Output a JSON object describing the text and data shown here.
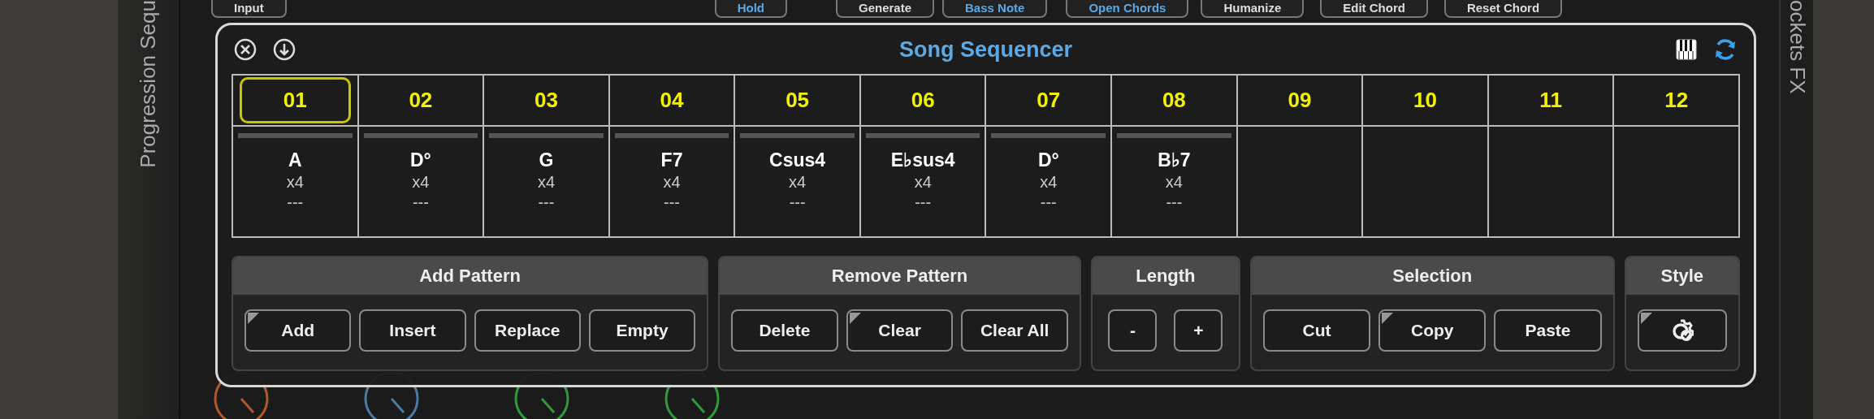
{
  "background": {
    "side_label": "Progression Sequ",
    "right_label": "ockets FX",
    "top_buttons": [
      {
        "label": "Input",
        "highlighted": false
      },
      {
        "label": "Hold",
        "highlighted": true
      },
      {
        "label": "Generate",
        "highlighted": false
      },
      {
        "label": "Bass Note",
        "highlighted": true
      },
      {
        "label": "Open Chords",
        "highlighted": true
      },
      {
        "label": "Humanize",
        "highlighted": false
      },
      {
        "label": "Edit Chord",
        "highlighted": false
      },
      {
        "label": "Reset Chord",
        "highlighted": false
      }
    ],
    "knobs": [
      {
        "color": "#b0582a"
      },
      {
        "color": "#4a7aa8"
      },
      {
        "color": "#2f9a3a"
      },
      {
        "color": "#2f9a3a"
      }
    ]
  },
  "window": {
    "title": "Song Sequencer",
    "slots": [
      {
        "number": "01",
        "selected": true,
        "chord": "A",
        "repeat": "x4",
        "pattern": "---"
      },
      {
        "number": "02",
        "selected": false,
        "chord": "D°",
        "repeat": "x4",
        "pattern": "---"
      },
      {
        "number": "03",
        "selected": false,
        "chord": "G",
        "repeat": "x4",
        "pattern": "---"
      },
      {
        "number": "04",
        "selected": false,
        "chord": "F7",
        "repeat": "x4",
        "pattern": "---"
      },
      {
        "number": "05",
        "selected": false,
        "chord": "Csus4",
        "repeat": "x4",
        "pattern": "---"
      },
      {
        "number": "06",
        "selected": false,
        "chord": "E♭sus4",
        "repeat": "x4",
        "pattern": "---"
      },
      {
        "number": "07",
        "selected": false,
        "chord": "D°",
        "repeat": "x4",
        "pattern": "---"
      },
      {
        "number": "08",
        "selected": false,
        "chord": "B♭7",
        "repeat": "x4",
        "pattern": "---"
      },
      {
        "number": "09",
        "selected": false
      },
      {
        "number": "10",
        "selected": false
      },
      {
        "number": "11",
        "selected": false
      },
      {
        "number": "12",
        "selected": false
      }
    ],
    "sections": [
      {
        "title": "Add Pattern",
        "buttons": [
          {
            "label": "Add",
            "corner_mark": true
          },
          {
            "label": "Insert",
            "corner_mark": false
          },
          {
            "label": "Replace",
            "corner_mark": false
          },
          {
            "label": "Empty",
            "corner_mark": false
          }
        ]
      },
      {
        "title": "Remove Pattern",
        "buttons": [
          {
            "label": "Delete",
            "corner_mark": false
          },
          {
            "label": "Clear",
            "corner_mark": true
          },
          {
            "label": "Clear All",
            "corner_mark": false
          }
        ]
      },
      {
        "title": "Length",
        "buttons": [
          {
            "label": "-",
            "corner_mark": false
          },
          {
            "label": "+",
            "corner_mark": false
          }
        ]
      },
      {
        "title": "Selection",
        "buttons": [
          {
            "label": "Cut",
            "corner_mark": false
          },
          {
            "label": "Copy",
            "corner_mark": true
          },
          {
            "label": "Paste",
            "corner_mark": false
          }
        ]
      },
      {
        "title": "Style",
        "buttons": [
          {
            "kind": "icon",
            "corner_mark": true
          }
        ]
      }
    ]
  }
}
